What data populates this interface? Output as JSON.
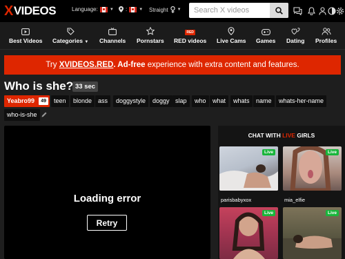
{
  "brand": {
    "x": "X",
    "rest": "VIDEOS"
  },
  "header": {
    "language_label": "Language:",
    "straight_label": "Straight",
    "search_placeholder": "Search X videos"
  },
  "nav": {
    "items": [
      {
        "label": "Best Videos",
        "icon": "play-square-icon"
      },
      {
        "label": "Categories",
        "icon": "tag-icon"
      },
      {
        "label": "Channels",
        "icon": "tv-icon"
      },
      {
        "label": "Pornstars",
        "icon": "star-icon"
      },
      {
        "label": "RED videos",
        "icon": "red-badge-icon",
        "badge": "RED"
      },
      {
        "label": "Live Cams",
        "icon": "live-pin-icon"
      },
      {
        "label": "Games",
        "icon": "gamepad-icon"
      },
      {
        "label": "Dating",
        "icon": "hearts-icon"
      },
      {
        "label": "Profiles",
        "icon": "users-icon"
      }
    ]
  },
  "promo": {
    "pre": "Try ",
    "brand": "XVIDEOS.RED",
    "bold": ". Ad-free",
    "post": " experience with extra content and features."
  },
  "video": {
    "title": "Who is she?",
    "duration": "33 sec",
    "uploader": "Yeabro99",
    "uploader_count": "49",
    "tags": [
      "teen",
      "blonde",
      "ass",
      "doggystyle",
      "doggy",
      "slap",
      "who",
      "what",
      "whats",
      "name",
      "whats-her-name",
      "who-is-she"
    ]
  },
  "player": {
    "error_text": "Loading error",
    "retry_label": "Retry"
  },
  "live": {
    "title_pre": "CHAT WITH ",
    "title_live": "LIVE",
    "title_post": " GIRLS",
    "badge": "Live",
    "cams": [
      {
        "name": "parisbabyxox"
      },
      {
        "name": "mia_elfie"
      },
      {
        "name": ""
      },
      {
        "name": ""
      }
    ]
  },
  "colors": {
    "accent": "#de2600",
    "live_green": "#19b53b",
    "background": "#1e1e1e"
  }
}
